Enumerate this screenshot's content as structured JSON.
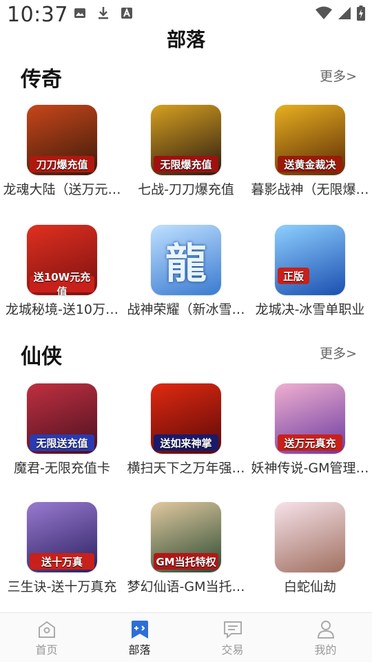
{
  "status_bar": {
    "time": "10:37"
  },
  "page_title": "部落",
  "sections": [
    {
      "title": "传奇",
      "more": "更多>",
      "games": [
        {
          "name": "龙魂大陆（送万元…",
          "badge": "刀刀爆充值",
          "colors": [
            "#3a1a0a",
            "#c8461a"
          ],
          "badge_color": "#b0180f"
        },
        {
          "name": "七战-刀刀爆充值",
          "badge": "无限爆充值",
          "colors": [
            "#2a1a10",
            "#d6a020"
          ],
          "badge_color": "#a01010"
        },
        {
          "name": "暮影战神（无限爆…",
          "badge": "送黄金裁决",
          "colors": [
            "#5a2a06",
            "#e8b020"
          ],
          "badge_color": "#9a1a08"
        },
        {
          "name": "龙城秘境-送10万…",
          "badge": "送10W元充值",
          "colors": [
            "#7a1010",
            "#e03020"
          ],
          "badge_color": "#c8201a"
        },
        {
          "name": "战神荣耀（新冰雪…",
          "badge": "龍",
          "colors": [
            "#3a7ad0",
            "#bfe0ff"
          ],
          "badge_color": ""
        },
        {
          "name": "龙城决-冰雪单职业",
          "badge": "正版",
          "colors": [
            "#1b4fb0",
            "#8fd0ff"
          ],
          "badge_color": "#c8201a"
        }
      ]
    },
    {
      "title": "仙侠",
      "more": "更多>",
      "games": [
        {
          "name": "魔君-无限充值卡",
          "badge": "无限送充值",
          "colors": [
            "#4a1020",
            "#c03040"
          ],
          "badge_color": "#2a3ab0"
        },
        {
          "name": "横扫天下之万年强…",
          "badge": "送如来神掌",
          "colors": [
            "#5a0808",
            "#e02a10"
          ],
          "badge_color": "#1a1a6a"
        },
        {
          "name": "妖神传说-GM管理…",
          "badge": "送万元真充",
          "colors": [
            "#6a3aa0",
            "#f0b0d0"
          ],
          "badge_color": "#c8201a"
        },
        {
          "name": "三生诀-送十万真充",
          "badge": "送十万真",
          "colors": [
            "#2a2060",
            "#9a7ad0"
          ],
          "badge_color": "#c8201a"
        },
        {
          "name": "梦幻仙语-GM当托…",
          "badge": "GM当托特权",
          "colors": [
            "#2a4a30",
            "#e0c8a0"
          ],
          "badge_color": "#b01818"
        },
        {
          "name": "白蛇仙劫",
          "badge": "",
          "colors": [
            "#a07060",
            "#f6e2ea"
          ],
          "badge_color": ""
        }
      ]
    }
  ],
  "bottom_nav": [
    {
      "label": "首页",
      "icon": "home-icon",
      "active": false
    },
    {
      "label": "部落",
      "icon": "bookmark-icon",
      "active": true
    },
    {
      "label": "交易",
      "icon": "chat-icon",
      "active": false
    },
    {
      "label": "我的",
      "icon": "profile-icon",
      "active": false
    }
  ],
  "colors": {
    "accent": "#2d6fd6",
    "inactive": "#999999"
  }
}
